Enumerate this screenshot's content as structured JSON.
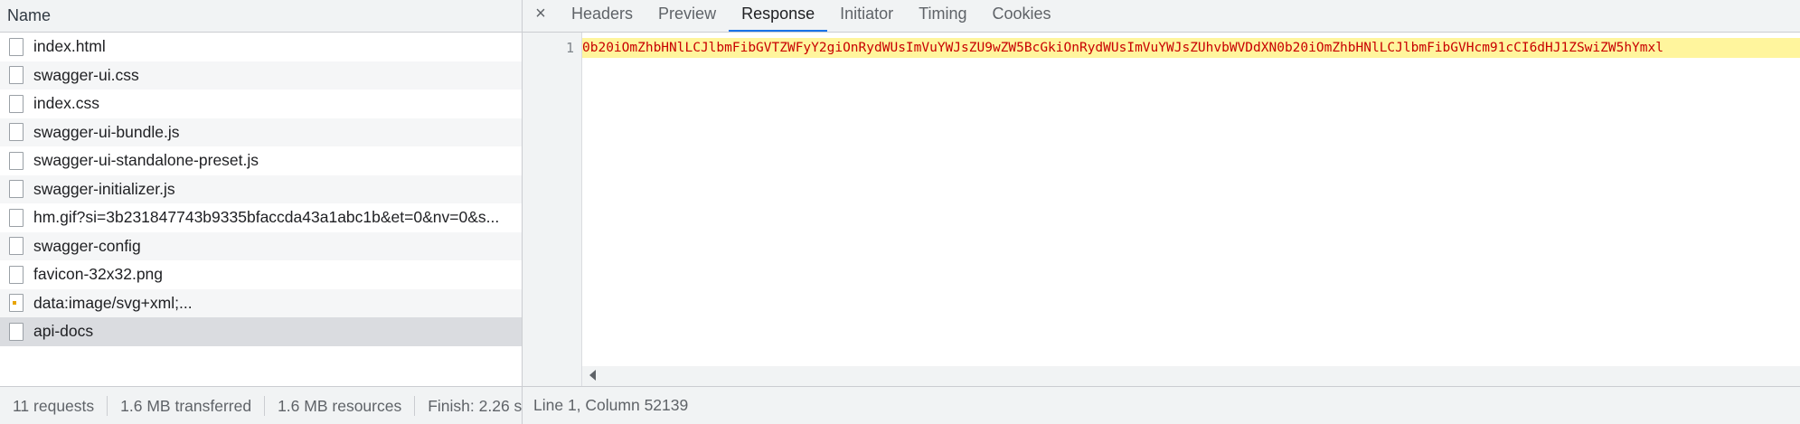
{
  "left_pane": {
    "column_header": "Name",
    "rows": [
      {
        "name": "index.html",
        "icon": "file-icon"
      },
      {
        "name": "swagger-ui.css",
        "icon": "file-icon"
      },
      {
        "name": "index.css",
        "icon": "file-icon"
      },
      {
        "name": "swagger-ui-bundle.js",
        "icon": "file-icon"
      },
      {
        "name": "swagger-ui-standalone-preset.js",
        "icon": "file-icon"
      },
      {
        "name": "swagger-initializer.js",
        "icon": "file-icon"
      },
      {
        "name": "hm.gif?si=3b231847743b9335bfaccda43a1abc1b&et=0&nv=0&s...",
        "icon": "file-icon"
      },
      {
        "name": "swagger-config",
        "icon": "file-icon"
      },
      {
        "name": "favicon-32x32.png",
        "icon": "file-icon"
      },
      {
        "name": "data:image/svg+xml;...",
        "icon": "image-file-icon"
      },
      {
        "name": "api-docs",
        "icon": "file-icon",
        "selected": true
      }
    ],
    "status": {
      "requests": "11 requests",
      "transferred": "1.6 MB transferred",
      "resources": "1.6 MB resources",
      "finish": "Finish: 2.26 s"
    }
  },
  "right_pane": {
    "close_label": "×",
    "tabs": [
      {
        "label": "Headers",
        "active": false
      },
      {
        "label": "Preview",
        "active": false
      },
      {
        "label": "Response",
        "active": true
      },
      {
        "label": "Initiator",
        "active": false
      },
      {
        "label": "Timing",
        "active": false
      },
      {
        "label": "Cookies",
        "active": false
      }
    ],
    "editor": {
      "line_number": "1",
      "line_text": "0b20iOmZhbHNlLCJlbmFibGVTZWFyY2giOnRydWUsImVuYWJsZU9wZW5BcGkiOnRydWUsImVuYWJsZUhvbWVDdXN0b20iOmZhbHNlLCJlbmFibGVHcm91cCI6dHJ1ZSwiZW5hYmxl"
    },
    "status": "Line 1, Column 52139"
  },
  "colors": {
    "accent": "#1a73e8",
    "highlight": "#fff59d",
    "code_text": "#c80000",
    "selected_row": "#dadce0"
  }
}
